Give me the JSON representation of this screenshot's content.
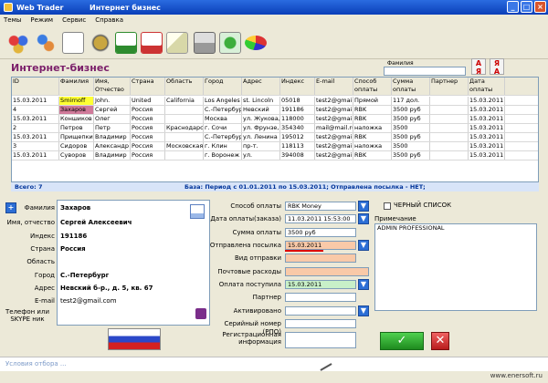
{
  "window": {
    "app_title": "Web Trader",
    "doc_title": "Интернет бизнес"
  },
  "menu": [
    "Темы",
    "Режим",
    "Сервис",
    "Справка"
  ],
  "heading": "Интернет-бизнес",
  "search": {
    "label": "Фамилия",
    "value": ""
  },
  "columns": [
    "ID",
    "Фамилия",
    "Имя, Отчество",
    "Страна",
    "Область",
    "Город",
    "Адрес",
    "Индекс",
    "E-mail",
    "Способ оплаты",
    "Сумма оплаты",
    "Партнер",
    "Дата оплаты"
  ],
  "rows": [
    [
      "15.03.2011",
      "Smirnoff",
      "John.",
      "United",
      "California",
      "Los Angeles",
      "st. Lincoln",
      "05018",
      "test2@gmail.com",
      "Прямой",
      "117 дол.",
      "",
      "15.03.2011"
    ],
    [
      "4",
      "Захаров",
      "Сергей",
      "Россия",
      "",
      "С.-Петербург",
      "Невский",
      "191186",
      "test2@gmail.com",
      "RBK",
      "3500 руб",
      "",
      "15.03.2011"
    ],
    [
      "15.03.2011",
      "Коншиков",
      "Олег",
      "Россия",
      "",
      "Москва",
      "ул. Жукова,",
      "118000",
      "test2@gmail.com",
      "RBK",
      "3500 руб",
      "",
      "15.03.2011"
    ],
    [
      "2",
      "Петров",
      "Петр",
      "Россия",
      "Краснодарский",
      "г. Сочи",
      "ул. Фрунзе,",
      "354340",
      "mail@mail.ru",
      "наложка",
      "3500",
      "",
      "15.03.2011"
    ],
    [
      "15.03.2011",
      "Прищепкин",
      "Владимир",
      "Россия",
      "",
      "С.-Петербург",
      "ул. Ленина",
      "195012",
      "test2@gmail.com",
      "RBK",
      "3500 руб",
      "",
      "15.03.2011"
    ],
    [
      "3",
      "Сидоров",
      "Александр",
      "Россия",
      "Московская",
      "г. Клин",
      "пр-т.",
      "118113",
      "test2@gmail.com",
      "наложка",
      "3500",
      "",
      "15.03.2011"
    ],
    [
      "15.03.2011",
      "Суворов",
      "Владимир",
      "Россия",
      "",
      "г. Воронеж",
      "ул.",
      "394008",
      "test2@gmail.com",
      "RBK",
      "3500 руб",
      "",
      "15.03.2011"
    ]
  ],
  "status": {
    "records": "Всего: 7",
    "period": "База: Период с 01.01.2011 по 15.03.2011; Отправлена посылка - НЕТ;"
  },
  "left_labels": [
    "Фамилия",
    "Имя, отчество",
    "Индекс",
    "Страна",
    "Область",
    "Город",
    "Адрес",
    "E-mail",
    "Телефон или SKYPE ник"
  ],
  "left_values": {
    "surname": "Захаров",
    "name": "Сергей Алексеевич",
    "index": "191186",
    "country": "Россия",
    "region": "",
    "city": "С.-Петербург",
    "address": "Невский б-р., д. 5, кв. 67",
    "email": "test2@gmail.com",
    "phone": ""
  },
  "mid_labels": [
    "Способ оплаты",
    "Дата оплаты(заказа)",
    "Сумма оплаты",
    "Отправлена посылка",
    "Вид отправки",
    "Почтовые расходы",
    "Оплата поступила",
    "Партнер",
    "Активировано",
    "Серийный номер (РПО)",
    "Регистрационная информация"
  ],
  "mid_values": {
    "pay_method": "RBK Money",
    "pay_date": "11.03.2011 15:53:00",
    "amount": "3500 руб",
    "sent": "15.03.2011",
    "ship_type": "",
    "post_cost": "",
    "received": "15.03.2011",
    "partner": "",
    "activated": "",
    "serial": "",
    "reginfo": ""
  },
  "blacklist_label": "ЧЕРНЫЙ СПИСОК",
  "note_label": "Примечание",
  "note_value": "ADMIN PROFESSIONAL",
  "footer_placeholder": "Условия отбора ...",
  "watermark": "www.enersoft.ru",
  "colors": {
    "accent": "#7b1f6a",
    "title_bar": "#0a3fb8",
    "highlight_yellow": "#ffff33",
    "highlight_pink": "#f9c9a8",
    "highlight_green": "#c8f0c8"
  }
}
